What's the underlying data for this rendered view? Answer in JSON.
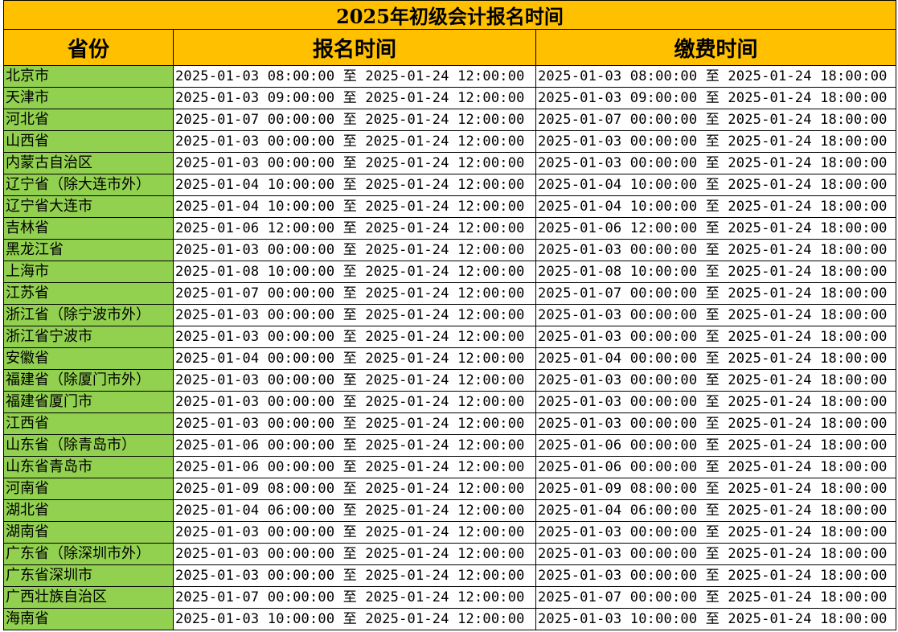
{
  "title": "2025年初级会计报名时间",
  "headers": {
    "province": "省份",
    "register": "报名时间",
    "payment": "缴费时间"
  },
  "colors": {
    "header_fill": "#ffc000",
    "province_fill": "#92d050",
    "grid": "#000000"
  },
  "rows": [
    {
      "province": "北京市",
      "register": "2025-01-03 08:00:00 至 2025-01-24 12:00:00",
      "payment": "2025-01-03 08:00:00 至 2025-01-24 18:00:00"
    },
    {
      "province": "天津市",
      "register": "2025-01-03 09:00:00 至 2025-01-24 12:00:00",
      "payment": "2025-01-03 09:00:00 至 2025-01-24 18:00:00"
    },
    {
      "province": "河北省",
      "register": "2025-01-07 00:00:00 至 2025-01-24 12:00:00",
      "payment": "2025-01-07 00:00:00 至 2025-01-24 18:00:00"
    },
    {
      "province": "山西省",
      "register": "2025-01-03 00:00:00 至 2025-01-24 12:00:00",
      "payment": "2025-01-03 00:00:00 至 2025-01-24 18:00:00"
    },
    {
      "province": "内蒙古自治区",
      "register": "2025-01-03 00:00:00 至 2025-01-24 12:00:00",
      "payment": "2025-01-03 00:00:00 至 2025-01-24 18:00:00"
    },
    {
      "province": "辽宁省（除大连市外）",
      "register": "2025-01-04 10:00:00 至 2025-01-24 12:00:00",
      "payment": "2025-01-04 10:00:00 至 2025-01-24 18:00:00"
    },
    {
      "province": "辽宁省大连市",
      "register": "2025-01-04 10:00:00 至 2025-01-24 12:00:00",
      "payment": "2025-01-04 10:00:00 至 2025-01-24 18:00:00"
    },
    {
      "province": "吉林省",
      "register": "2025-01-06 12:00:00 至 2025-01-24 12:00:00",
      "payment": "2025-01-06 12:00:00 至 2025-01-24 18:00:00"
    },
    {
      "province": "黑龙江省",
      "register": "2025-01-03 00:00:00 至 2025-01-24 12:00:00",
      "payment": "2025-01-03 00:00:00 至 2025-01-24 18:00:00"
    },
    {
      "province": "上海市",
      "register": "2025-01-08 10:00:00 至 2025-01-24 12:00:00",
      "payment": "2025-01-08 10:00:00 至 2025-01-24 18:00:00"
    },
    {
      "province": "江苏省",
      "register": "2025-01-07 00:00:00 至 2025-01-24 12:00:00",
      "payment": "2025-01-07 00:00:00 至 2025-01-24 18:00:00"
    },
    {
      "province": "浙江省（除宁波市外）",
      "register": "2025-01-03 00:00:00 至 2025-01-24 12:00:00",
      "payment": "2025-01-03 00:00:00 至 2025-01-24 18:00:00"
    },
    {
      "province": "浙江省宁波市",
      "register": "2025-01-03 00:00:00 至 2025-01-24 12:00:00",
      "payment": "2025-01-03 00:00:00 至 2025-01-24 18:00:00"
    },
    {
      "province": "安徽省",
      "register": "2025-01-04 00:00:00 至 2025-01-24 12:00:00",
      "payment": "2025-01-04 00:00:00 至 2025-01-24 18:00:00"
    },
    {
      "province": "福建省（除厦门市外）",
      "register": "2025-01-03 00:00:00 至 2025-01-24 12:00:00",
      "payment": "2025-01-03 00:00:00 至 2025-01-24 18:00:00"
    },
    {
      "province": "福建省厦门市",
      "register": "2025-01-03 00:00:00 至 2025-01-24 12:00:00",
      "payment": "2025-01-03 00:00:00 至 2025-01-24 18:00:00"
    },
    {
      "province": "江西省",
      "register": "2025-01-03 00:00:00 至 2025-01-24 12:00:00",
      "payment": "2025-01-03 00:00:00 至 2025-01-24 18:00:00"
    },
    {
      "province": "山东省（除青岛市）",
      "register": "2025-01-06 00:00:00 至 2025-01-24 12:00:00",
      "payment": "2025-01-06 00:00:00 至 2025-01-24 18:00:00"
    },
    {
      "province": "山东省青岛市",
      "register": "2025-01-06 00:00:00 至 2025-01-24 12:00:00",
      "payment": "2025-01-06 00:00:00 至 2025-01-24 18:00:00"
    },
    {
      "province": "河南省",
      "register": "2025-01-09 08:00:00 至 2025-01-24 12:00:00",
      "payment": "2025-01-09 08:00:00 至 2025-01-24 18:00:00"
    },
    {
      "province": "湖北省",
      "register": "2025-01-04 06:00:00 至 2025-01-24 12:00:00",
      "payment": "2025-01-04 06:00:00 至 2025-01-24 18:00:00"
    },
    {
      "province": "湖南省",
      "register": "2025-01-03 00:00:00 至 2025-01-24 12:00:00",
      "payment": "2025-01-03 00:00:00 至 2025-01-24 18:00:00"
    },
    {
      "province": "广东省（除深圳市外）",
      "register": "2025-01-03 00:00:00 至 2025-01-24 12:00:00",
      "payment": "2025-01-03 00:00:00 至 2025-01-24 18:00:00"
    },
    {
      "province": "广东省深圳市",
      "register": "2025-01-03 00:00:00 至 2025-01-24 12:00:00",
      "payment": "2025-01-03 00:00:00 至 2025-01-24 18:00:00"
    },
    {
      "province": "广西壮族自治区",
      "register": "2025-01-07 00:00:00 至 2025-01-24 12:00:00",
      "payment": "2025-01-07 00:00:00 至 2025-01-24 18:00:00"
    },
    {
      "province": "海南省",
      "register": "2025-01-03 10:00:00 至 2025-01-24 12:00:00",
      "payment": "2025-01-03 10:00:00 至 2025-01-24 18:00:00"
    }
  ]
}
